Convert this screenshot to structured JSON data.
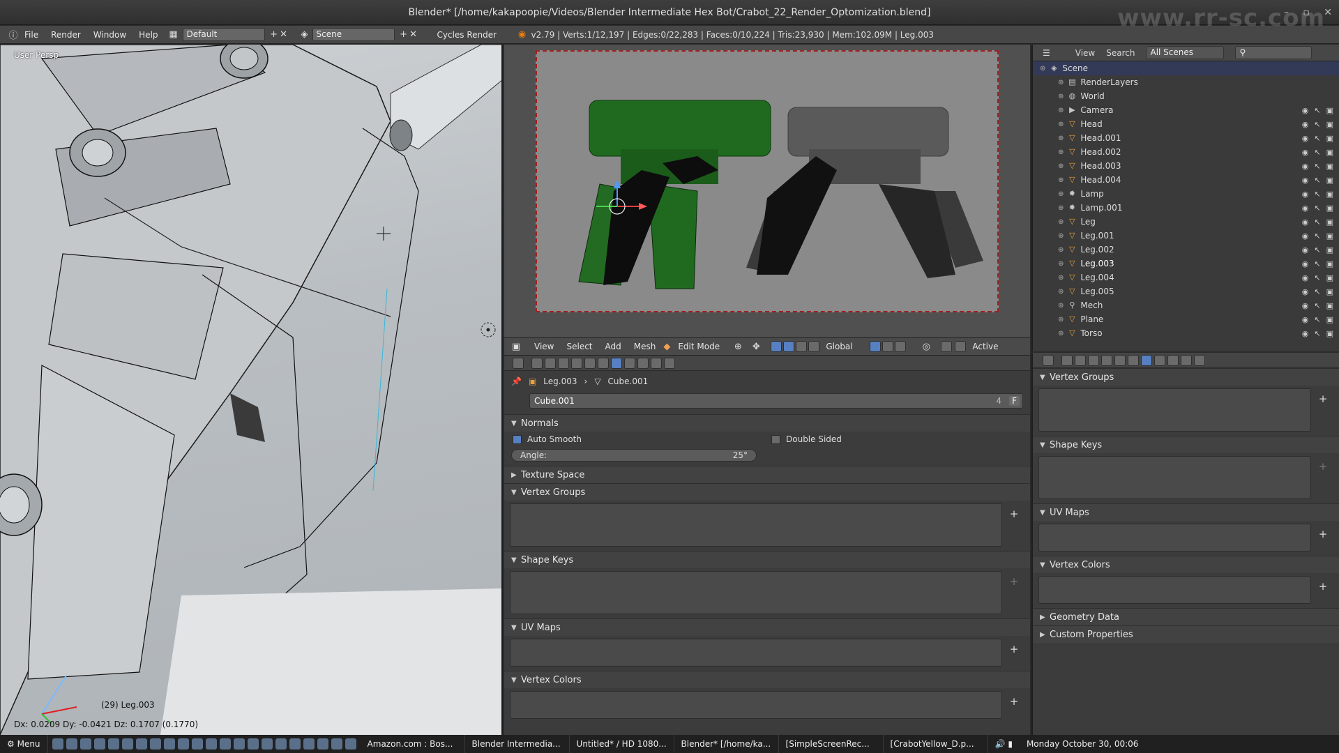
{
  "window": {
    "title": "Blender* [/home/kakapoopie/Videos/Blender Intermediate Hex Bot/Crabot_22_Render_Optomization.blend]",
    "watermark": "www.rr-sc.com"
  },
  "infobar": {
    "menus": [
      "File",
      "Render",
      "Window",
      "Help"
    ],
    "layout": "Default",
    "scene": "Scene",
    "engine": "Cycles Render",
    "stats": "v2.79 | Verts:1/12,197 | Edges:0/22,283 | Faces:0/10,224 | Tris:23,930 | Mem:102.09M | Leg.003"
  },
  "viewport": {
    "label": "User Persp",
    "object_label": "(29) Leg.003",
    "delta": "Dx: 0.0209   Dy: -0.0421   Dz: 0.1707 (0.1770)"
  },
  "header3d": {
    "menus": [
      "View",
      "Select",
      "Add",
      "Mesh"
    ],
    "mode": "Edit Mode",
    "orientation": "Global",
    "active": "Active"
  },
  "props_left": {
    "crumb_object": "Leg.003",
    "crumb_mesh": "Cube.001",
    "mesh_name": "Cube.001",
    "mesh_users": "4",
    "fake_user": "F",
    "normals": "Normals",
    "auto_smooth": "Auto Smooth",
    "double_sided": "Double Sided",
    "angle_label": "Angle:",
    "angle_value": "25°",
    "texture_space": "Texture Space",
    "vertex_groups": "Vertex Groups",
    "shape_keys": "Shape Keys",
    "uv_maps": "UV Maps",
    "vertex_colors": "Vertex Colors"
  },
  "outliner": {
    "menus": [
      "View",
      "Search"
    ],
    "filter": "All Scenes",
    "items": [
      {
        "name": "Scene",
        "icon": "scene-icon",
        "level": 0
      },
      {
        "name": "RenderLayers",
        "icon": "render-layers-icon",
        "level": 1
      },
      {
        "name": "World",
        "icon": "world-icon",
        "level": 1
      },
      {
        "name": "Camera",
        "icon": "camera-icon",
        "level": 1
      },
      {
        "name": "Head",
        "icon": "mesh-icon",
        "level": 1
      },
      {
        "name": "Head.001",
        "icon": "mesh-icon",
        "level": 1
      },
      {
        "name": "Head.002",
        "icon": "mesh-icon",
        "level": 1
      },
      {
        "name": "Head.003",
        "icon": "mesh-icon",
        "level": 1
      },
      {
        "name": "Head.004",
        "icon": "mesh-icon",
        "level": 1
      },
      {
        "name": "Lamp",
        "icon": "lamp-icon",
        "level": 1
      },
      {
        "name": "Lamp.001",
        "icon": "lamp-icon",
        "level": 1
      },
      {
        "name": "Leg",
        "icon": "mesh-icon",
        "level": 1
      },
      {
        "name": "Leg.001",
        "icon": "mesh-icon",
        "level": 1
      },
      {
        "name": "Leg.002",
        "icon": "mesh-icon",
        "level": 1
      },
      {
        "name": "Leg.003",
        "icon": "mesh-icon",
        "level": 1
      },
      {
        "name": "Leg.004",
        "icon": "mesh-icon",
        "level": 1
      },
      {
        "name": "Leg.005",
        "icon": "mesh-icon",
        "level": 1
      },
      {
        "name": "Mech",
        "icon": "armature-icon",
        "level": 1
      },
      {
        "name": "Plane",
        "icon": "mesh-icon",
        "level": 1
      },
      {
        "name": "Torso",
        "icon": "mesh-icon",
        "level": 1
      }
    ]
  },
  "props_right": {
    "vertex_groups": "Vertex Groups",
    "shape_keys": "Shape Keys",
    "uv_maps": "UV Maps",
    "vertex_colors": "Vertex Colors",
    "geometry_data": "Geometry Data",
    "custom_properties": "Custom Properties"
  },
  "taskbar": {
    "menu": "Menu",
    "tasks": [
      "Amazon.com : Bos...",
      "Blender Intermedia...",
      "Untitled* / HD 1080...",
      "Blender* [/home/ka...",
      "[SimpleScreenRec...",
      "[CrabotYellow_D.p..."
    ],
    "clock": "Monday October 30, 00:06"
  },
  "colors": {
    "accent": "#5680c2",
    "selected_row": "#333a57",
    "render_border": "#a02020"
  }
}
